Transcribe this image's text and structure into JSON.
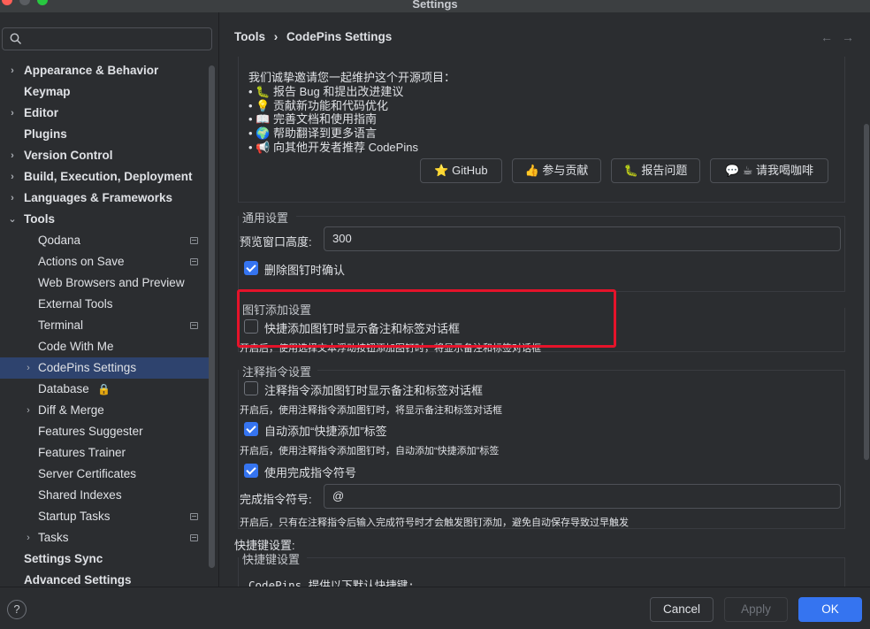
{
  "window": {
    "title": "Settings"
  },
  "search": {
    "placeholder": ""
  },
  "sidebar": {
    "items": [
      {
        "label": "Appearance & Behavior",
        "bold": true,
        "chevron": "›",
        "indent": 0
      },
      {
        "label": "Keymap",
        "bold": true,
        "chevron": "",
        "indent": 0
      },
      {
        "label": "Editor",
        "bold": true,
        "chevron": "›",
        "indent": 0
      },
      {
        "label": "Plugins",
        "bold": true,
        "chevron": "",
        "indent": 0
      },
      {
        "label": "Version Control",
        "bold": true,
        "chevron": "›",
        "indent": 0
      },
      {
        "label": "Build, Execution, Deployment",
        "bold": true,
        "chevron": "›",
        "indent": 0
      },
      {
        "label": "Languages & Frameworks",
        "bold": true,
        "chevron": "›",
        "indent": 0
      },
      {
        "label": "Tools",
        "bold": true,
        "chevron": "⌄",
        "indent": 0
      },
      {
        "label": "Qodana",
        "bold": false,
        "chevron": "",
        "indent": 1,
        "gear": true
      },
      {
        "label": "Actions on Save",
        "bold": false,
        "chevron": "",
        "indent": 1,
        "gear": true
      },
      {
        "label": "Web Browsers and Preview",
        "bold": false,
        "chevron": "",
        "indent": 1
      },
      {
        "label": "External Tools",
        "bold": false,
        "chevron": "",
        "indent": 1
      },
      {
        "label": "Terminal",
        "bold": false,
        "chevron": "",
        "indent": 1,
        "gear": true
      },
      {
        "label": "Code With Me",
        "bold": false,
        "chevron": "",
        "indent": 1
      },
      {
        "label": "CodePins Settings",
        "bold": false,
        "chevron": "›",
        "indent": 1,
        "selected": true
      },
      {
        "label": "Database",
        "bold": false,
        "chevron": "",
        "indent": 1,
        "lock": true
      },
      {
        "label": "Diff & Merge",
        "bold": false,
        "chevron": "›",
        "indent": 1
      },
      {
        "label": "Features Suggester",
        "bold": false,
        "chevron": "",
        "indent": 1
      },
      {
        "label": "Features Trainer",
        "bold": false,
        "chevron": "",
        "indent": 1
      },
      {
        "label": "Server Certificates",
        "bold": false,
        "chevron": "",
        "indent": 1
      },
      {
        "label": "Shared Indexes",
        "bold": false,
        "chevron": "",
        "indent": 1
      },
      {
        "label": "Startup Tasks",
        "bold": false,
        "chevron": "",
        "indent": 1,
        "gear": true
      },
      {
        "label": "Tasks",
        "bold": false,
        "chevron": "›",
        "indent": 1,
        "gear": true
      },
      {
        "label": "Settings Sync",
        "bold": true,
        "chevron": "",
        "indent": 0
      },
      {
        "label": "Advanced Settings",
        "bold": true,
        "chevron": "",
        "indent": 0
      }
    ]
  },
  "header": {
    "crumb1": "Tools",
    "separator": "›",
    "crumb2": "CodePins Settings",
    "back": "←",
    "forward": "→"
  },
  "intro": {
    "heading": "我们诚挚邀请您一起维护这个开源项目：",
    "bullets": [
      "• 🐛 报告 Bug 和提出改进建议",
      "• 💡 贡献新功能和代码优化",
      "• 📖 完善文档和使用指南",
      "• 🌍 帮助翻译到更多语言",
      "• 📢 向其他开发者推荐 CodePins"
    ],
    "buttons": {
      "github": "⭐ GitHub",
      "contribute": "👍 参与贡献",
      "report": "🐛 报告问题",
      "coffee": "💬 ☕ 请我喝咖啡"
    }
  },
  "general": {
    "title": "通用设置",
    "preview_height_label": "预览窗口高度:",
    "preview_height_value": "300",
    "confirm_delete_label": "删除图钉时确认",
    "confirm_delete_checked": true
  },
  "pin_add": {
    "title": "图钉添加设置",
    "quick_add_label": "快捷添加图钉时显示备注和标签对话框",
    "quick_add_checked": false,
    "quick_add_hint": "开启后，使用选择文本浮动按钮添加图钉时，将显示备注和标签对话框"
  },
  "comment": {
    "title": "注释指令设置",
    "dialog_label": "注释指令添加图钉时显示备注和标签对话框",
    "dialog_checked": false,
    "dialog_hint": "开启后，使用注释指令添加图钉时，将显示备注和标签对话框",
    "auto_tag_label": "自动添加“快捷添加”标签",
    "auto_tag_checked": true,
    "auto_tag_hint": "开启后，使用注释指令添加图钉时，自动添加“快捷添加”标签",
    "completion_label": "使用完成指令符号",
    "completion_checked": true,
    "symbol_label": "完成指令符号:",
    "symbol_value": "@",
    "symbol_hint": "开启后，只有在注释指令后输入完成符号时才会触发图钉添加，避免自动保存导致过早触发"
  },
  "shortcut": {
    "outer_title": "快捷键设置:",
    "inner_title": "快捷键设置",
    "desc": "CodePins 提供以下默认快捷键:"
  },
  "footer": {
    "help": "?",
    "cancel": "Cancel",
    "apply": "Apply",
    "ok": "OK"
  },
  "colors": {
    "accent": "#3574f0",
    "selection": "#2e436e",
    "highlight_box": "#e5132a",
    "background": "#2b2d30"
  }
}
